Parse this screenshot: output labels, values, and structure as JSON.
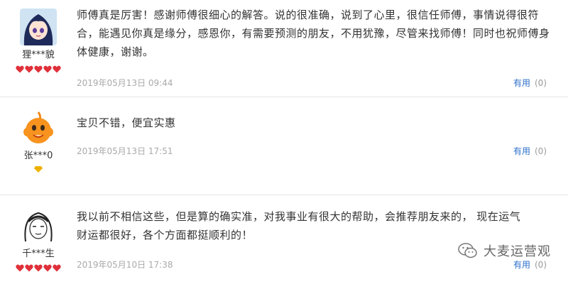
{
  "reviews": [
    {
      "username": "狸***貌",
      "text": "师傅真是厉害！感谢师傅很细心的解答。说的很准确，说到了心里，很信任师傅，事情说得很符合，能遇见你真是缘分，感恩你，有需要预测的朋友，不用犹豫，尽管来找师傅！同时也祝师傅身体健康，谢谢。",
      "date": "2019年05月13日 09:44",
      "useful_label": "有用",
      "useful_count": "(0)",
      "level_icon": "heart-icon",
      "level_count": 5
    },
    {
      "username": "张***0",
      "text": "宝贝不错，便宜实惠",
      "date": "2019年05月13日 17:51",
      "useful_label": "有用",
      "useful_count": "(0)",
      "level_icon": "diamond-icon",
      "level_count": 1
    },
    {
      "username": "千***生",
      "text": "我以前不相信这些，但是算的确实准，对我事业有很大的帮助，会推荐朋友来的，  现在运气财运都很好，各个方面都挺顺利的！",
      "date": "2019年05月10日 17:38",
      "useful_label": "有用",
      "useful_count": "(0)",
      "level_icon": "heart-icon",
      "level_count": 5
    }
  ],
  "watermark": {
    "text": "大麦运营观",
    "icon": "wechat-icon"
  },
  "colors": {
    "useful_link": "#2b6fcb",
    "date": "#aaaaaa",
    "heart": "#e0303a",
    "diamond": "#f0b400"
  }
}
